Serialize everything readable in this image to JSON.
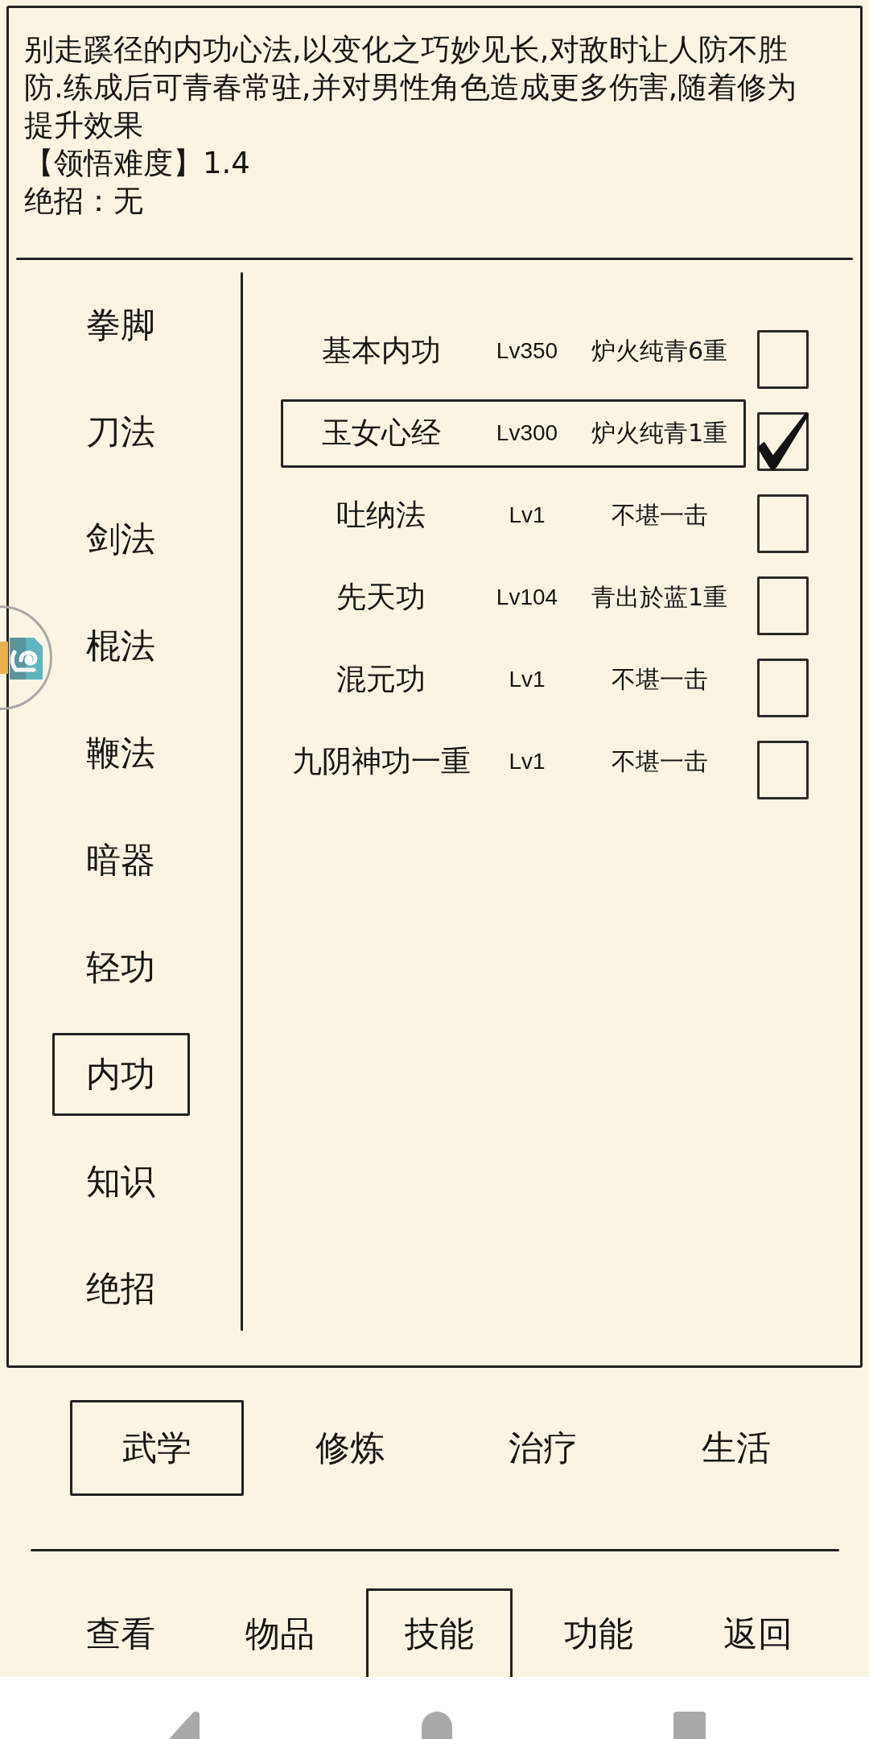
{
  "description": {
    "text": "别走蹊径的内功心法,以变化之巧妙见长,对敌时让人防不胜防.练成后可青春常驻,并对男性角色造成更多伤害,随着修为提升效果",
    "difficulty": "【领悟难度】1.4",
    "ultimate": "绝招：无"
  },
  "categories": [
    {
      "label": "拳脚",
      "selected": false
    },
    {
      "label": "刀法",
      "selected": false
    },
    {
      "label": "剑法",
      "selected": false
    },
    {
      "label": "棍法",
      "selected": false
    },
    {
      "label": "鞭法",
      "selected": false
    },
    {
      "label": "暗器",
      "selected": false
    },
    {
      "label": "轻功",
      "selected": false
    },
    {
      "label": "内功",
      "selected": true
    },
    {
      "label": "知识",
      "selected": false
    },
    {
      "label": "绝招",
      "selected": false
    }
  ],
  "skills": [
    {
      "name": "基本内功",
      "lv": "Lv350",
      "rank": "炉火纯青6重",
      "selected": false,
      "checked": false
    },
    {
      "name": "玉女心经",
      "lv": "Lv300",
      "rank": "炉火纯青1重",
      "selected": true,
      "checked": true
    },
    {
      "name": "吐纳法",
      "lv": "Lv1",
      "rank": "不堪一击",
      "selected": false,
      "checked": false
    },
    {
      "name": "先天功",
      "lv": "Lv104",
      "rank": "青出於蓝1重",
      "selected": false,
      "checked": false
    },
    {
      "name": "混元功",
      "lv": "Lv1",
      "rank": "不堪一击",
      "selected": false,
      "checked": false
    },
    {
      "name": "九阴神功一重",
      "lv": "Lv1",
      "rank": "不堪一击",
      "selected": false,
      "checked": false
    }
  ],
  "tabs": [
    {
      "label": "武学",
      "selected": true
    },
    {
      "label": "修炼",
      "selected": false
    },
    {
      "label": "治疗",
      "selected": false
    },
    {
      "label": "生活",
      "selected": false
    }
  ],
  "nav": [
    {
      "label": "查看",
      "selected": false
    },
    {
      "label": "物品",
      "selected": false
    },
    {
      "label": "技能",
      "selected": true
    },
    {
      "label": "功能",
      "selected": false
    },
    {
      "label": "返回",
      "selected": false
    }
  ]
}
